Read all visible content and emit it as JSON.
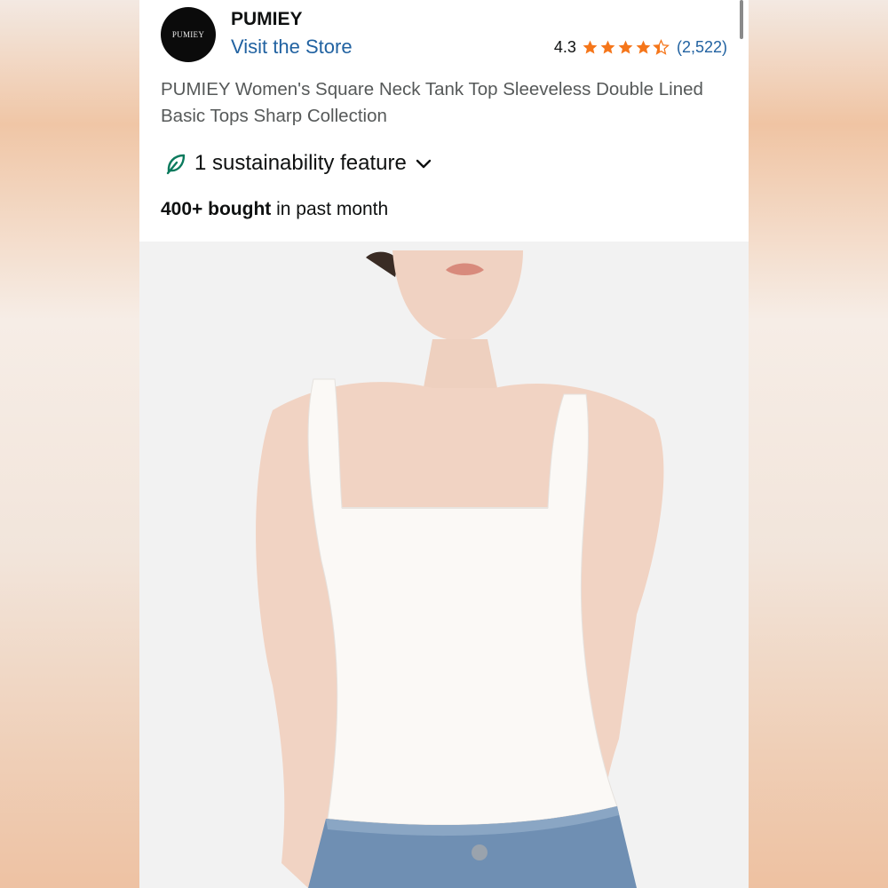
{
  "store": {
    "logo_text": "PUMIEY",
    "brand": "PUMIEY",
    "visit_label": "Visit the Store"
  },
  "rating": {
    "value": "4.3",
    "count": "(2,522)",
    "stars_filled": 4.3,
    "star_color": "#f5761a"
  },
  "product": {
    "title": "PUMIEY Women's Square Neck Tank Top Sleeveless Double Lined Basic Tops Sharp Collection"
  },
  "sustainability": {
    "label": "1 sustainability feature",
    "icon": "leaf-icon",
    "icon_color": "#0b7a5d"
  },
  "social_proof": {
    "bold": "400+ bought",
    "rest": " in past month"
  },
  "colors": {
    "link": "#2162a1",
    "text": "#0f1111",
    "muted": "#565959"
  }
}
